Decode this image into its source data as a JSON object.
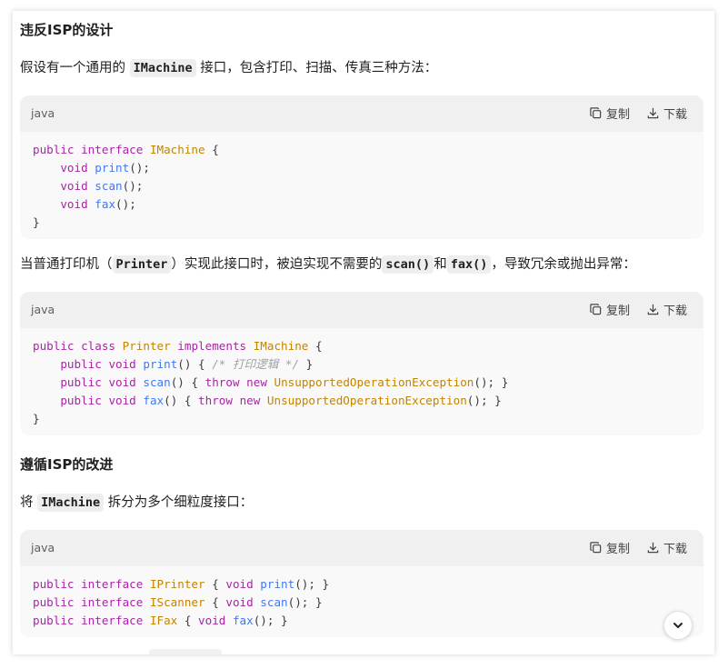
{
  "sections": {
    "violate_heading": "违反ISP的设计",
    "intro": {
      "before": "假设有一个通用的",
      "code": "IMachine",
      "after": "接口，包含打印、扫描、传真三种方法："
    },
    "printer_para": {
      "part1": "当普通打印机（",
      "code1": "Printer",
      "part2": "）实现此接口时，被迫实现不需要的",
      "code2": "scan()",
      "part3": "和",
      "code3": "fax()",
      "part4": "，导致冗余或抛出异常："
    },
    "follow_heading": "遵循ISP的改进",
    "split_para": {
      "before": "将",
      "code": "IMachine",
      "after": "拆分为多个细粒度接口："
    }
  },
  "code_blocks": [
    {
      "lang": "java",
      "copy_label": "复制",
      "download_label": "下载",
      "lines": [
        [
          [
            "kw",
            "public"
          ],
          [
            "p",
            " "
          ],
          [
            "kw",
            "interface"
          ],
          [
            "p",
            " "
          ],
          [
            "cls",
            "IMachine"
          ],
          [
            "p",
            " {"
          ]
        ],
        [
          [
            "p",
            "    "
          ],
          [
            "kw",
            "void"
          ],
          [
            "p",
            " "
          ],
          [
            "fn",
            "print"
          ],
          [
            "p",
            "();"
          ]
        ],
        [
          [
            "p",
            "    "
          ],
          [
            "kw",
            "void"
          ],
          [
            "p",
            " "
          ],
          [
            "fn",
            "scan"
          ],
          [
            "p",
            "();"
          ]
        ],
        [
          [
            "p",
            "    "
          ],
          [
            "kw",
            "void"
          ],
          [
            "p",
            " "
          ],
          [
            "fn",
            "fax"
          ],
          [
            "p",
            "();"
          ]
        ],
        [
          [
            "p",
            "}"
          ]
        ]
      ]
    },
    {
      "lang": "java",
      "copy_label": "复制",
      "download_label": "下载",
      "lines": [
        [
          [
            "kw",
            "public"
          ],
          [
            "p",
            " "
          ],
          [
            "kw",
            "class"
          ],
          [
            "p",
            " "
          ],
          [
            "cls",
            "Printer"
          ],
          [
            "p",
            " "
          ],
          [
            "kw",
            "implements"
          ],
          [
            "p",
            " "
          ],
          [
            "cls",
            "IMachine"
          ],
          [
            "p",
            " {"
          ]
        ],
        [
          [
            "p",
            "    "
          ],
          [
            "kw",
            "public"
          ],
          [
            "p",
            " "
          ],
          [
            "kw",
            "void"
          ],
          [
            "p",
            " "
          ],
          [
            "fn",
            "print"
          ],
          [
            "p",
            "() { "
          ],
          [
            "cm",
            "/* 打印逻辑 */"
          ],
          [
            "p",
            " }"
          ]
        ],
        [
          [
            "p",
            "    "
          ],
          [
            "kw",
            "public"
          ],
          [
            "p",
            " "
          ],
          [
            "kw",
            "void"
          ],
          [
            "p",
            " "
          ],
          [
            "fn",
            "scan"
          ],
          [
            "p",
            "() { "
          ],
          [
            "kw",
            "throw"
          ],
          [
            "p",
            " "
          ],
          [
            "kw",
            "new"
          ],
          [
            "p",
            " "
          ],
          [
            "cls",
            "UnsupportedOperationException"
          ],
          [
            "p",
            "(); }"
          ]
        ],
        [
          [
            "p",
            "    "
          ],
          [
            "kw",
            "public"
          ],
          [
            "p",
            " "
          ],
          [
            "kw",
            "void"
          ],
          [
            "p",
            " "
          ],
          [
            "fn",
            "fax"
          ],
          [
            "p",
            "() { "
          ],
          [
            "kw",
            "throw"
          ],
          [
            "p",
            " "
          ],
          [
            "kw",
            "new"
          ],
          [
            "p",
            " "
          ],
          [
            "cls",
            "UnsupportedOperationException"
          ],
          [
            "p",
            "(); }"
          ]
        ],
        [
          [
            "p",
            "}"
          ]
        ]
      ]
    },
    {
      "lang": "java",
      "copy_label": "复制",
      "download_label": "下载",
      "lines": [
        [
          [
            "kw",
            "public"
          ],
          [
            "p",
            " "
          ],
          [
            "kw",
            "interface"
          ],
          [
            "p",
            " "
          ],
          [
            "cls",
            "IPrinter"
          ],
          [
            "p",
            " { "
          ],
          [
            "kw",
            "void"
          ],
          [
            "p",
            " "
          ],
          [
            "fn",
            "print"
          ],
          [
            "p",
            "(); }"
          ]
        ],
        [
          [
            "kw",
            "public"
          ],
          [
            "p",
            " "
          ],
          [
            "kw",
            "interface"
          ],
          [
            "p",
            " "
          ],
          [
            "cls",
            "IScanner"
          ],
          [
            "p",
            " { "
          ],
          [
            "kw",
            "void"
          ],
          [
            "p",
            " "
          ],
          [
            "fn",
            "scan"
          ],
          [
            "p",
            "(); }"
          ]
        ],
        [
          [
            "kw",
            "public"
          ],
          [
            "p",
            " "
          ],
          [
            "kw",
            "interface"
          ],
          [
            "p",
            " "
          ],
          [
            "cls",
            "IFax"
          ],
          [
            "p",
            " { "
          ],
          [
            "kw",
            "void"
          ],
          [
            "p",
            " "
          ],
          [
            "fn",
            "fax"
          ],
          [
            "p",
            "(); }"
          ]
        ]
      ]
    }
  ],
  "icons": {
    "copy": "copy-icon",
    "download": "download-icon",
    "scroll": "chevron-down-icon"
  },
  "colors": {
    "keyword": "#a626a4",
    "class_name": "#c18401",
    "function": "#4078f2",
    "comment": "#a0a1a7",
    "inline_code_bg": "#eeeeee",
    "code_header_bg": "#f0f0f0",
    "code_body_bg": "#f9f9f9"
  }
}
